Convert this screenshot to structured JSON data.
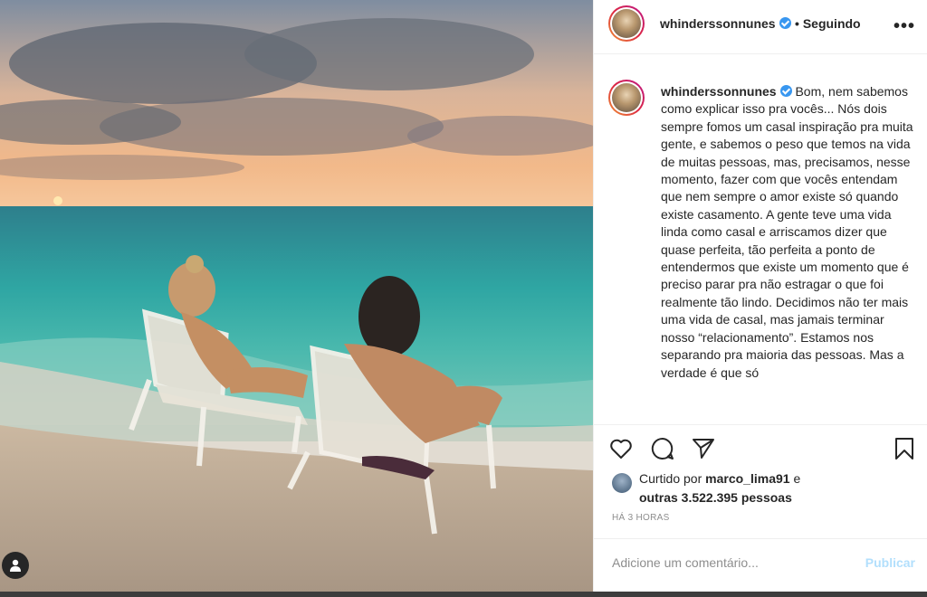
{
  "post": {
    "username": "whinderssonnunes",
    "follow_status": "• Seguindo",
    "more_label": "•••",
    "caption": "Bom, nem sabemos como explicar isso pra vocês... Nós dois sempre fomos um casal inspiração pra muita gente, e sabemos o peso que temos na vida de muitas pessoas, mas, precisamos, nesse momento, fazer com que vocês entendam que nem sempre o amor existe só quando existe casamento. A gente teve uma vida linda como casal e arriscamos dizer que quase perfeita, tão perfeita a ponto de entendermos que existe um momento que é preciso parar pra não estragar o que foi realmente tão lindo. Decidimos não ter mais uma vida de casal, mas jamais terminar nosso “relacionamento”. Estamos nos separando pra maioria das pessoas. Mas a verdade é que só",
    "liked_by_prefix": "Curtido por",
    "liked_by_user": "marco_lima91",
    "liked_by_joiner": "e",
    "liked_others": "outras 3.522.395 pessoas",
    "time_ago": "HÁ 3 HORAS"
  },
  "comment": {
    "placeholder": "Adicione um comentário...",
    "publish_label": "Publicar"
  },
  "icons": {
    "like": "heart-icon",
    "comment": "comment-icon",
    "share": "share-icon",
    "save": "bookmark-icon",
    "user": "user-icon",
    "verified": "verified-badge-icon"
  },
  "colors": {
    "verified": "#3897f0",
    "publish_disabled": "#b2dffc",
    "text_secondary": "#8e8e8e"
  }
}
